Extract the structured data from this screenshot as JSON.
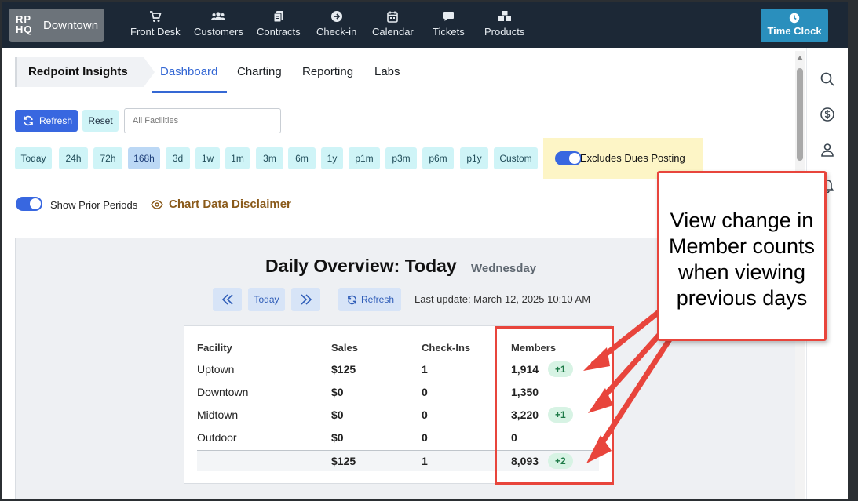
{
  "topbar": {
    "logo_mark": "RP\nHQ",
    "location": "Downtown",
    "nav": [
      {
        "label": "Front Desk",
        "icon": "cart-icon"
      },
      {
        "label": "Customers",
        "icon": "users-icon"
      },
      {
        "label": "Contracts",
        "icon": "contracts-icon"
      },
      {
        "label": "Check-in",
        "icon": "arrow-circle-icon"
      },
      {
        "label": "Calendar",
        "icon": "calendar-icon"
      },
      {
        "label": "Tickets",
        "icon": "chat-icon"
      },
      {
        "label": "Products",
        "icon": "boxes-icon"
      }
    ],
    "time_clock": "Time Clock"
  },
  "breadcrumb": "Redpoint Insights",
  "tabs": [
    "Dashboard",
    "Charting",
    "Reporting",
    "Labs"
  ],
  "active_tab": "Dashboard",
  "toolbar": {
    "refresh": "Refresh",
    "reset": "Reset",
    "facility_placeholder": "All Facilities"
  },
  "periods": [
    "Today",
    "24h",
    "72h",
    "168h",
    "3d",
    "1w",
    "1m",
    "3m",
    "6m",
    "1y",
    "p1m",
    "p3m",
    "p6m",
    "p1y",
    "Custom"
  ],
  "active_period": "168h",
  "dues_toggle": {
    "label": "Excludes Dues Posting",
    "on": true
  },
  "prior_toggle": {
    "label": "Show Prior Periods",
    "on": true
  },
  "disclaimer": "Chart Data Disclaimer",
  "overview": {
    "title": "Daily Overview: Today",
    "day": "Wednesday",
    "today_btn": "Today",
    "refresh_btn": "Refresh",
    "last_update": "Last update: March 12, 2025 10:10 AM"
  },
  "table": {
    "headers": [
      "Facility",
      "Sales",
      "Check-Ins",
      "Members"
    ],
    "rows": [
      {
        "facility": "Uptown",
        "sales": "$125",
        "checkins": "1",
        "members": "1,914",
        "delta": "+1"
      },
      {
        "facility": "Downtown",
        "sales": "$0",
        "checkins": "0",
        "members": "1,350",
        "delta": ""
      },
      {
        "facility": "Midtown",
        "sales": "$0",
        "checkins": "0",
        "members": "3,220",
        "delta": "+1"
      },
      {
        "facility": "Outdoor",
        "sales": "$0",
        "checkins": "0",
        "members": "0",
        "delta": ""
      }
    ],
    "total": {
      "sales": "$125",
      "checkins": "1",
      "members": "8,093",
      "delta": "+2"
    }
  },
  "annotation": {
    "callout": "View change in Member counts when viewing previous days",
    "color": "#e8453c"
  },
  "colors": {
    "topbar": "#1c2836",
    "accent": "#3867e0",
    "period_bg": "#cff4f7",
    "time_clock": "#2a8fbd"
  }
}
